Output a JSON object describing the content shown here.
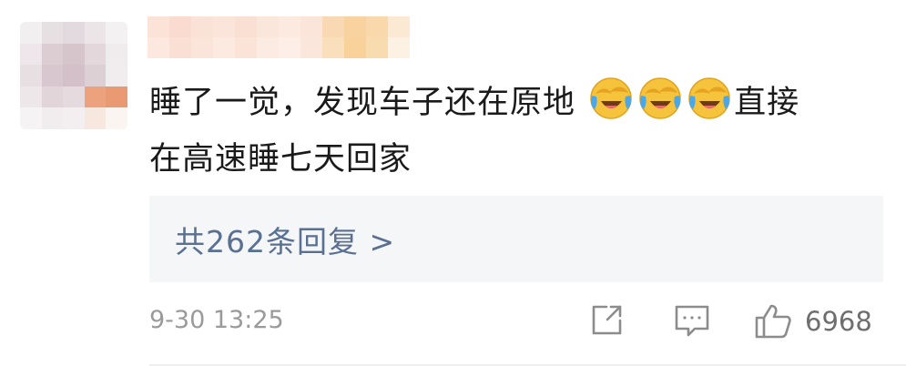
{
  "comment": {
    "line1": "睡了一觉，发现车子还在原地",
    "line1_tail": "直接",
    "line2": "在高速睡七天回家",
    "emoji_name": "laugh-cry-emoji"
  },
  "replies": {
    "label": "共262条回复 >"
  },
  "meta": {
    "timestamp": "9-30 13:25",
    "like_count": "6968"
  },
  "icons": {
    "share": "share-icon",
    "reply": "reply-icon",
    "like": "thumbs-up-icon"
  },
  "colors": {
    "link": "#5a7092",
    "text": "#1a1a1a",
    "muted": "#9a9a9a",
    "reply_bg": "#f5f6f7",
    "emoji_yellow": "#f6c33c",
    "emoji_tears": "#4aa8ea"
  }
}
